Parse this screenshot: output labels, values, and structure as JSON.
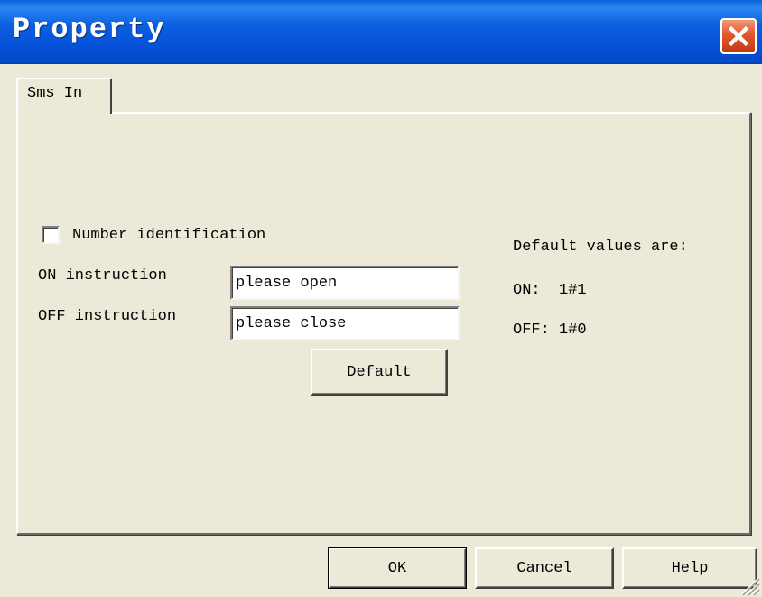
{
  "window": {
    "title": "Property"
  },
  "tabs": [
    {
      "label": "Sms In"
    }
  ],
  "form": {
    "number_identification_label": "Number identification",
    "number_identification_checked": false,
    "on_label": "ON instruction",
    "on_value": "please open",
    "off_label": "OFF instruction",
    "off_value": "please close",
    "default_button": "Default"
  },
  "defaults_info": {
    "heading": "Default values are:",
    "on_text": "ON:  1#1",
    "off_text": "OFF: 1#0"
  },
  "footer": {
    "ok": "OK",
    "cancel": "Cancel",
    "help": "Help"
  },
  "icons": {
    "close": "close-icon",
    "resize": "resize-grip-icon"
  },
  "colors": {
    "titlebar": "#0551d8",
    "close": "#e2562d",
    "face": "#ece9d8"
  }
}
